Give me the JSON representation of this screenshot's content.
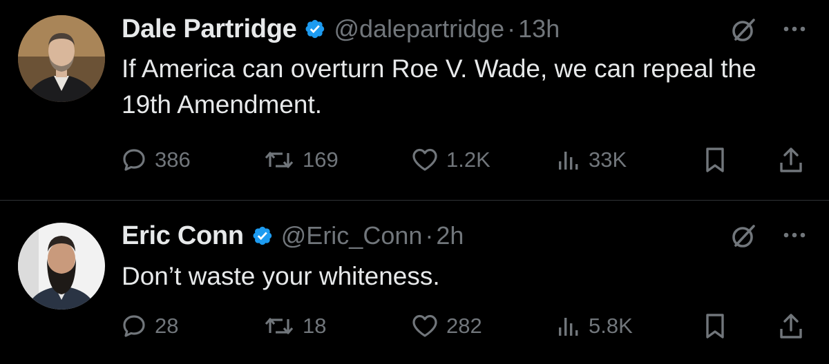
{
  "tweets": [
    {
      "display_name": "Dale Partridge",
      "handle": "@dalepartridge",
      "separator": "·",
      "time": "13h",
      "text": "If America can overturn Roe V. Wade, we can repeal the 19th Amendment.",
      "replies": "386",
      "reposts": "169",
      "likes": "1.2K",
      "views": "33K"
    },
    {
      "display_name": "Eric Conn",
      "handle": "@Eric_Conn",
      "separator": "·",
      "time": "2h",
      "text": "Don’t waste your whiteness.",
      "replies": "28",
      "reposts": "18",
      "likes": "282",
      "views": "5.8K"
    }
  ],
  "icons": {
    "verified": "verified-badge-icon",
    "grok": "grok-icon",
    "more": "more-icon",
    "reply": "reply-icon",
    "repost": "repost-icon",
    "like": "heart-icon",
    "views": "views-icon",
    "bookmark": "bookmark-icon",
    "share": "share-icon"
  },
  "colors": {
    "background": "#000000",
    "text_primary": "#e7e9ea",
    "text_secondary": "#71767b",
    "verified_blue": "#1d9bf0",
    "divider": "#2f3336"
  }
}
